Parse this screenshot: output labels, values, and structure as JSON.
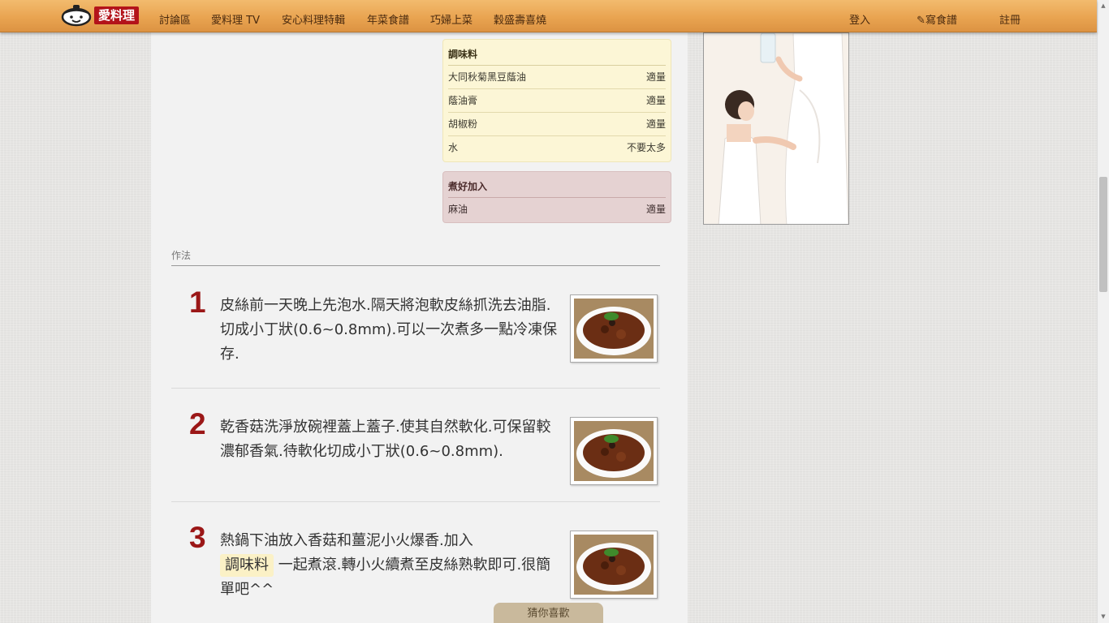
{
  "nav": {
    "logo_text": "愛料理",
    "items": [
      "討論區",
      "愛料理 TV",
      "安心料理特輯",
      "年菜食譜",
      "巧婦上菜",
      "穀盛壽喜燒"
    ],
    "login": "登入",
    "write_recipe": "寫食譜",
    "register": "註冊"
  },
  "seasoning": {
    "title": "調味料",
    "rows": [
      {
        "name": "大同秋菊黑豆蔭油",
        "amount": "適量"
      },
      {
        "name": "蔭油膏",
        "amount": "適量"
      },
      {
        "name": "胡椒粉",
        "amount": "適量"
      },
      {
        "name": "水",
        "amount": "不要太多"
      }
    ]
  },
  "finish": {
    "title": "煮好加入",
    "rows": [
      {
        "name": "麻油",
        "amount": "適量"
      }
    ]
  },
  "method": {
    "title": "作法",
    "steps": [
      {
        "num": "1",
        "text": "皮絲前一天晚上先泡水.隔天將泡軟皮絲抓洗去油脂.切成小丁狀(0.6~0.8mm).可以一次煮多一點冷凍保存."
      },
      {
        "num": "2",
        "text": "乾香菇洗淨放碗裡蓋上蓋子.使其自然軟化.可保留較濃郁香氣.待軟化切成小丁狀(0.6~0.8mm)."
      },
      {
        "num": "3",
        "text_before": "熱鍋下油放入香菇和薑泥小火爆香.加入",
        "tag": "調味料",
        "text_after": "一起煮滾.轉小火續煮至皮絲熟軟即可.很簡單吧^^"
      }
    ]
  },
  "guess_button": "猜你喜歡",
  "colors": {
    "nav_bg": "#e9a451",
    "step_number": "#9b1717",
    "seasoning_bg": "#fcf6d6",
    "finish_bg": "#e5d2d2",
    "brand_red": "#b3131a"
  }
}
